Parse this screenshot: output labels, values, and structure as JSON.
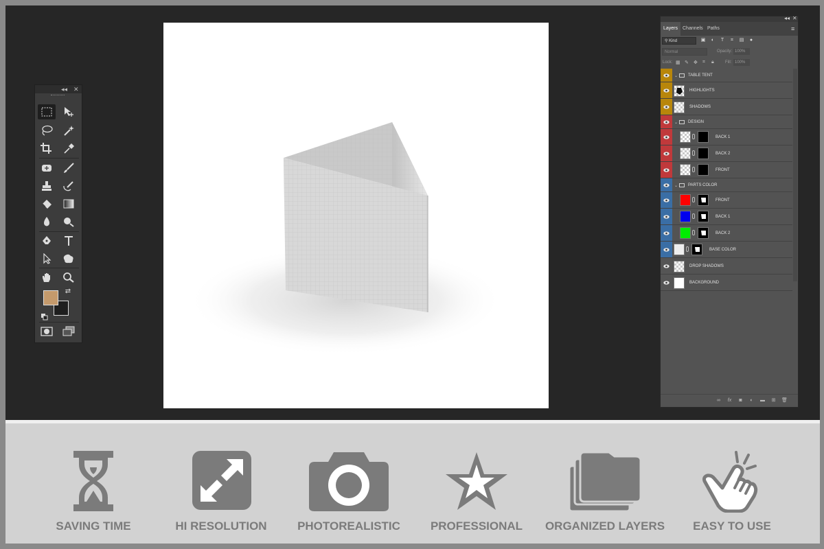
{
  "tools_panel": {
    "collapse_glyph": "◂◂",
    "close_glyph": "✕",
    "foreground_color": "#c49a6c",
    "background_color": "#1e1e1e"
  },
  "layers_panel": {
    "collapse_glyph": "◂◂",
    "close_glyph": "✕",
    "tabs": [
      "Layers",
      "Channels",
      "Paths"
    ],
    "menu_glyph": "≡",
    "filter_kind": "Kind",
    "blend_mode": "Normal",
    "opacity_label": "Opacity:",
    "opacity_value": "100%",
    "lock_label": "Lock:",
    "fill_label": "Fill:",
    "fill_value": "100%",
    "group_colors": {
      "table_tent": "#b8860b",
      "design": "#c0393b",
      "parts_color": "#3a6ea5",
      "none": "#555555"
    },
    "layers": [
      {
        "name": "TABLE TENT",
        "kind": "group",
        "color": "table_tent"
      },
      {
        "name": "HIGHLIGHTS",
        "kind": "layer",
        "color": "table_tent"
      },
      {
        "name": "SHADOWS",
        "kind": "layer",
        "color": "table_tent"
      },
      {
        "name": "DESIGN",
        "kind": "group",
        "color": "design"
      },
      {
        "name": "BACK 1",
        "kind": "smart",
        "color": "design"
      },
      {
        "name": "BACK 2",
        "kind": "smart",
        "color": "design"
      },
      {
        "name": "FRONT",
        "kind": "smart",
        "color": "design"
      },
      {
        "name": "PARTS COLOR",
        "kind": "group",
        "color": "parts_color"
      },
      {
        "name": "FRONT",
        "kind": "fill",
        "color": "parts_color",
        "swatch": "#ff0000"
      },
      {
        "name": "BACK 1",
        "kind": "fill",
        "color": "parts_color",
        "swatch": "#0000ee"
      },
      {
        "name": "BACK 2",
        "kind": "fill",
        "color": "parts_color",
        "swatch": "#00ee00"
      },
      {
        "name": "BASE COLOR",
        "kind": "fill",
        "color": "parts_color",
        "swatch": "#eeeeee"
      },
      {
        "name": "DROP SHADOWS",
        "kind": "layer",
        "color": "none"
      },
      {
        "name": "BACKGROUND",
        "kind": "layer",
        "color": "none"
      }
    ]
  },
  "features": [
    {
      "label": "SAVING TIME",
      "icon": "hourglass-icon"
    },
    {
      "label": "HI RESOLUTION",
      "icon": "expand-icon"
    },
    {
      "label": "PHOTOREALISTIC",
      "icon": "camera-icon"
    },
    {
      "label": "PROFESSIONAL",
      "icon": "star-icon"
    },
    {
      "label": "ORGANIZED LAYERS",
      "icon": "layers-icon"
    },
    {
      "label": "EASY TO USE",
      "icon": "hand-tap-icon"
    }
  ]
}
